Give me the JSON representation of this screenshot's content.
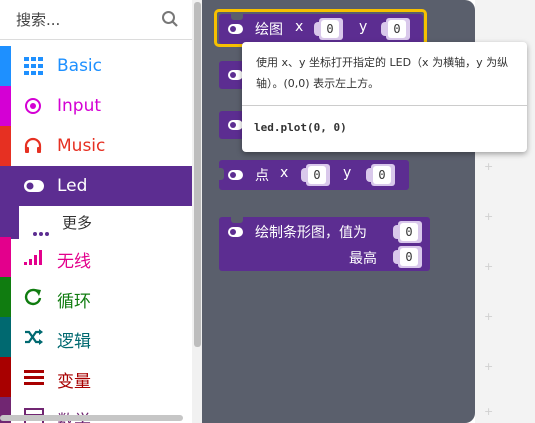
{
  "search": {
    "placeholder": "搜索..."
  },
  "categories": [
    {
      "label": "Basic",
      "color": "#1e90ff",
      "icon": "grid-icon"
    },
    {
      "label": "Input",
      "color": "#d400d4",
      "icon": "target-icon"
    },
    {
      "label": "Music",
      "color": "#e63022",
      "icon": "headphones-icon"
    },
    {
      "label": "Led",
      "color": "#5c2d91",
      "icon": "toggle-icon"
    },
    {
      "label": "无线",
      "color": "#e3008c",
      "icon": "signal-icon"
    },
    {
      "label": "循环",
      "color": "#107c10",
      "icon": "refresh-icon"
    },
    {
      "label": "逻辑",
      "color": "#006970",
      "icon": "shuffle-icon"
    },
    {
      "label": "变量",
      "color": "#a80000",
      "icon": "list-icon"
    },
    {
      "label": "数学",
      "color": "#712672",
      "icon": "calculator-icon"
    }
  ],
  "submenu": {
    "label": "更多"
  },
  "blocks": {
    "plot": {
      "label": "绘图",
      "x_label": "x",
      "y_label": "y",
      "x": "0",
      "y": "0"
    },
    "point": {
      "label": "点",
      "x_label": "x",
      "y_label": "y",
      "x": "0",
      "y": "0"
    },
    "bar": {
      "label": "绘制条形图，值为",
      "max_label": "最高",
      "value": "0",
      "max": "0"
    }
  },
  "tooltip": {
    "description": "使用 x、y 坐标打开指定的 LED（x 为横轴，y 为纵轴）。(0,0) 表示左上方。",
    "code": "led.plot(0, 0)"
  },
  "colors": {
    "led": "#5c2d91",
    "flyout": "#5a5f6c",
    "highlight": "#f7c000"
  }
}
